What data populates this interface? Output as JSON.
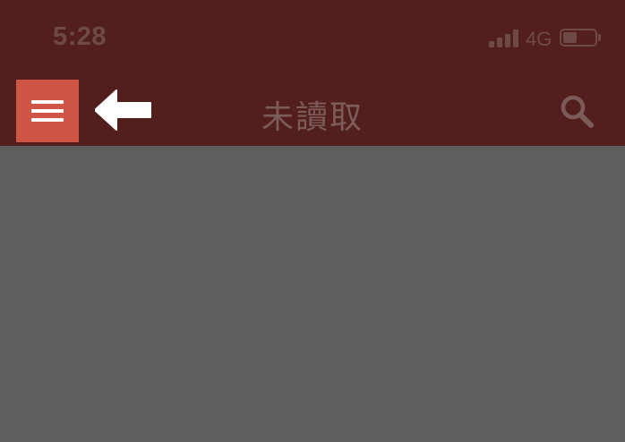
{
  "status_bar": {
    "time": "5:28",
    "network": "4G",
    "signal_bars": 4,
    "battery_level": 0.45
  },
  "app_bar": {
    "title": "未讀取",
    "menu_icon": "hamburger-menu-icon",
    "search_icon": "search-icon",
    "annotation_icon": "arrow-left-icon"
  },
  "colors": {
    "app_bar": "#521f1c",
    "menu_button": "#cf5547",
    "overlay": "#5e5e5e"
  }
}
